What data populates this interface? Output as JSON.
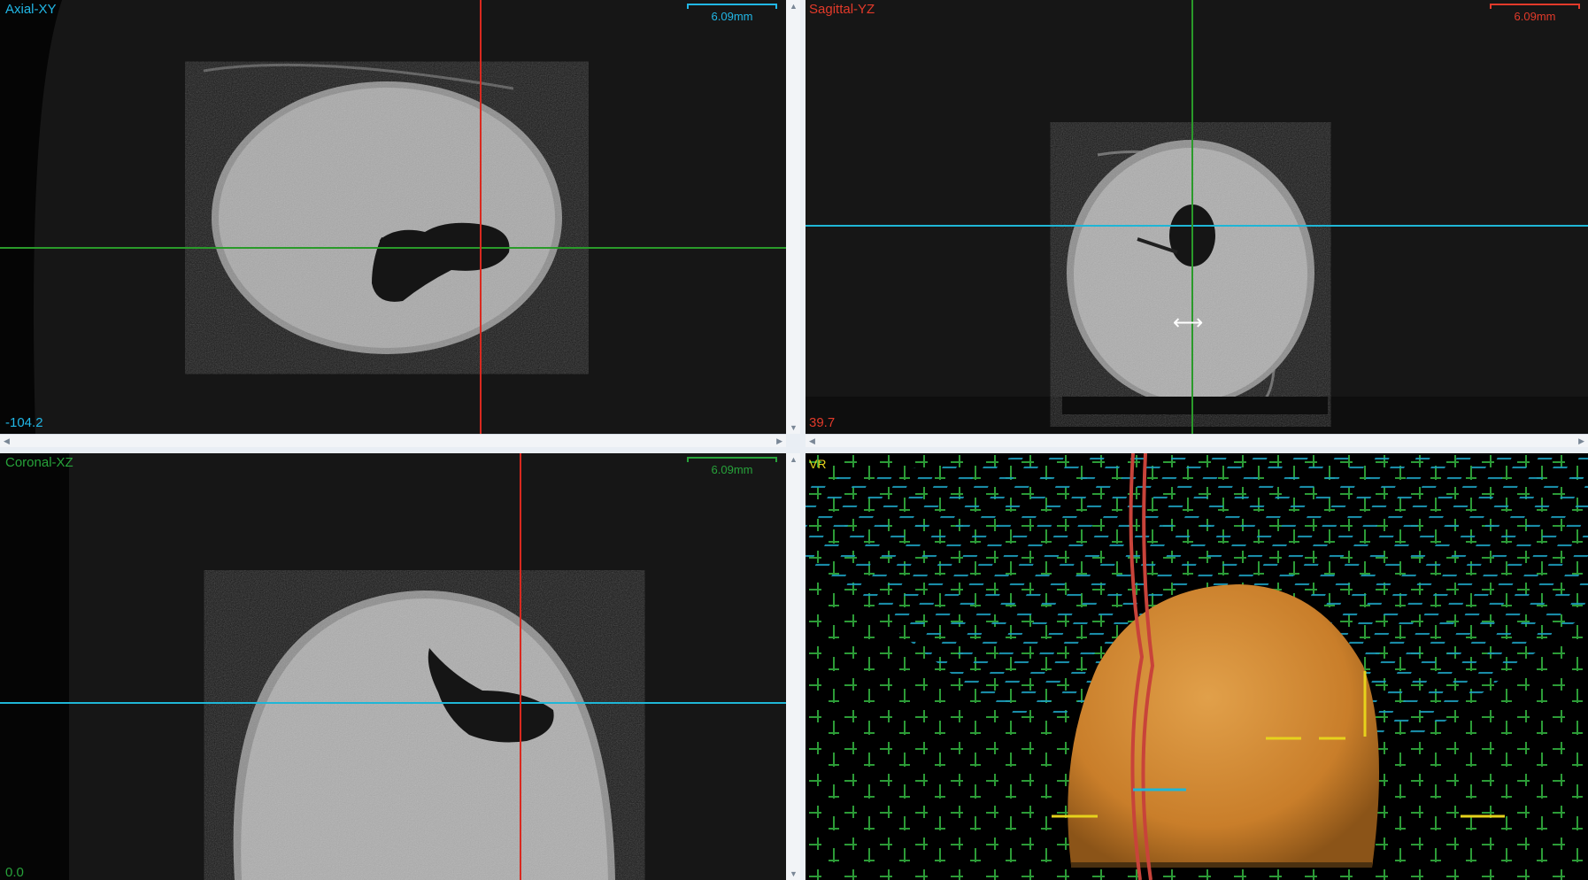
{
  "viewports": {
    "axial": {
      "title": "Axial-XY",
      "scale": "6.09mm",
      "slice": "-104.2",
      "color": "#21b7e6"
    },
    "sagittal": {
      "title": "Sagittal-YZ",
      "scale": "6.09mm",
      "slice": "39.7",
      "color": "#e23a2a"
    },
    "coronal": {
      "title": "Coronal-XZ",
      "scale": "6.09mm",
      "slice": "0.0",
      "color": "#27a23a"
    },
    "vr": {
      "title": "VR",
      "color": "#e6d21c"
    }
  },
  "crosshair_colors": {
    "red": "#d9291f",
    "green": "#2a9a2a",
    "cyan": "#1fb6d6"
  },
  "icons": {
    "cursor": "resize-horizontal-icon"
  }
}
